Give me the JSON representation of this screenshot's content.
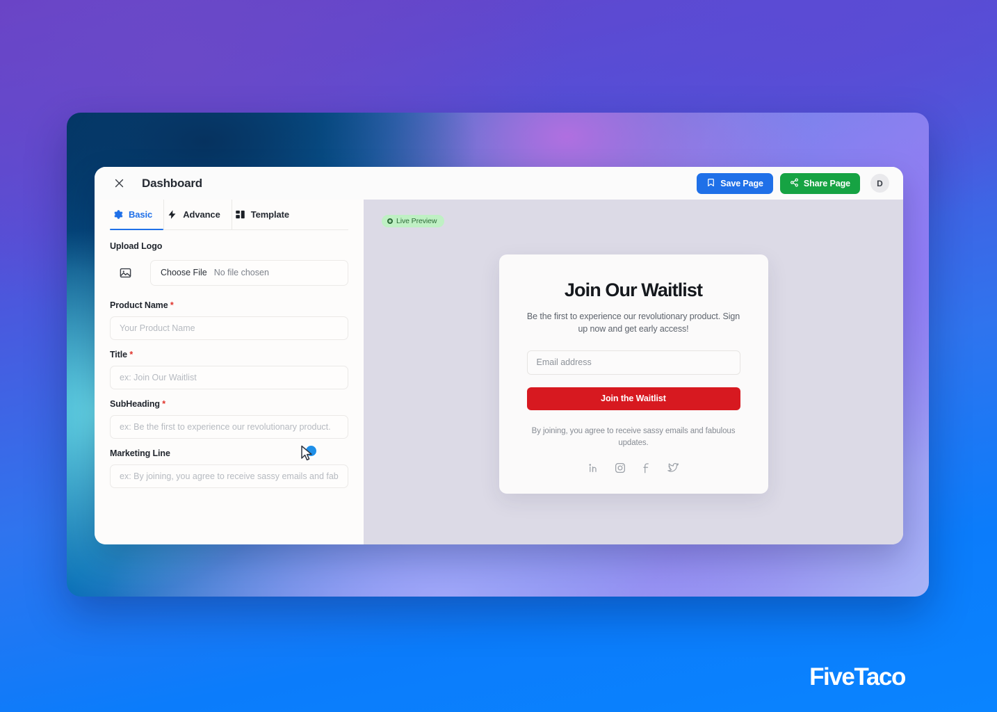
{
  "window": {
    "title": "Dashboard",
    "close_icon": "close-x-icon",
    "avatar_initial": "D",
    "save_label": "Save Page",
    "save_icon": "bookmark-icon",
    "save_color": "#1f70e8",
    "share_label": "Share Page",
    "share_icon": "share-nodes-icon",
    "share_color": "#16a343"
  },
  "tabs": [
    {
      "label": "Basic",
      "icon": "gear-icon",
      "active": true
    },
    {
      "label": "Advance",
      "icon": "lightning-bolt-icon",
      "active": false
    },
    {
      "label": "Template",
      "icon": "layout-grid-icon",
      "active": false
    }
  ],
  "form": {
    "upload_logo_label": "Upload Logo",
    "upload_thumb_icon": "image-placeholder-icon",
    "choose_file_label": "Choose File",
    "no_file_label": "No file chosen",
    "fields": [
      {
        "label": "Product Name",
        "required": true,
        "placeholder": "Your Product Name",
        "value": ""
      },
      {
        "label": "Title",
        "required": true,
        "placeholder": "ex: Join Our Waitlist",
        "value": ""
      },
      {
        "label": "SubHeading",
        "required": true,
        "placeholder": "ex: Be the first to experience our revolutionary product.",
        "value": ""
      },
      {
        "label": "Marketing Line",
        "required": false,
        "placeholder": "ex: By joining, you agree to receive sassy emails and fab",
        "value": ""
      }
    ],
    "required_marker": "*"
  },
  "preview": {
    "badge_label": "Live Preview",
    "badge_icon": "record-dot-icon",
    "badge_bg": "#bff0c4",
    "badge_text_color": "#2d6b38",
    "card": {
      "heading": "Join Our Waitlist",
      "subheading": "Be the first to experience our revolutionary product. Sign up now and get early access!",
      "email_placeholder": "Email address",
      "email_value": "",
      "cta_label": "Join the Waitlist",
      "cta_color": "#d71920",
      "disclaimer": "By joining, you agree to receive sassy emails and fabulous updates.",
      "socials": [
        {
          "name": "linkedin-icon"
        },
        {
          "name": "instagram-icon"
        },
        {
          "name": "facebook-icon"
        },
        {
          "name": "twitter-icon"
        }
      ]
    }
  },
  "brand": {
    "wordmark": "FiveTaco"
  }
}
